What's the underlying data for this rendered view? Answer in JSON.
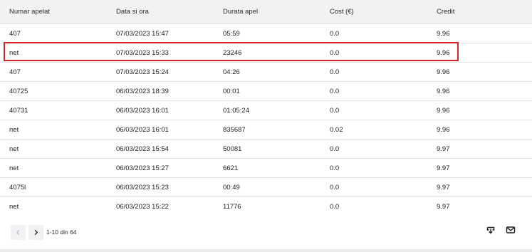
{
  "table": {
    "columns": [
      "Numar apelat",
      "Data si ora",
      "Durata apel",
      "Cost (€)",
      "Credit"
    ],
    "rows": [
      [
        "407",
        "07/03/2023 15:47",
        "05:59",
        "0.0",
        "9.96"
      ],
      [
        "net",
        "07/03/2023 15:33",
        "23246",
        "0.0",
        "9.96"
      ],
      [
        "407",
        "07/03/2023 15:24",
        "04:26",
        "0.0",
        "9.96"
      ],
      [
        "40725",
        "06/03/2023 18:39",
        "00:01",
        "0.0",
        "9.96"
      ],
      [
        "40731",
        "06/03/2023 16:01",
        "01:05:24",
        "0.0",
        "9.96"
      ],
      [
        "net",
        "06/03/2023 16:01",
        "835687",
        "0.02",
        "9.96"
      ],
      [
        "net",
        "06/03/2023 15:54",
        "50081",
        "0.0",
        "9.97"
      ],
      [
        "net",
        "06/03/2023 15:27",
        "6621",
        "0.0",
        "9.97"
      ],
      [
        "4075l",
        "06/03/2023 15:23",
        "00:49",
        "0.0",
        "9.97"
      ],
      [
        "net",
        "06/03/2023 15:22",
        "11776",
        "0.0",
        "9.97"
      ]
    ],
    "highlight_color": "#d8252b"
  },
  "pagination": {
    "range_text": "1-10 din 64",
    "prev_icon": "chevron-left-icon",
    "next_icon": "chevron-right-icon"
  },
  "actions": {
    "download_icon": "download-icon",
    "mail_icon": "mail-icon"
  }
}
